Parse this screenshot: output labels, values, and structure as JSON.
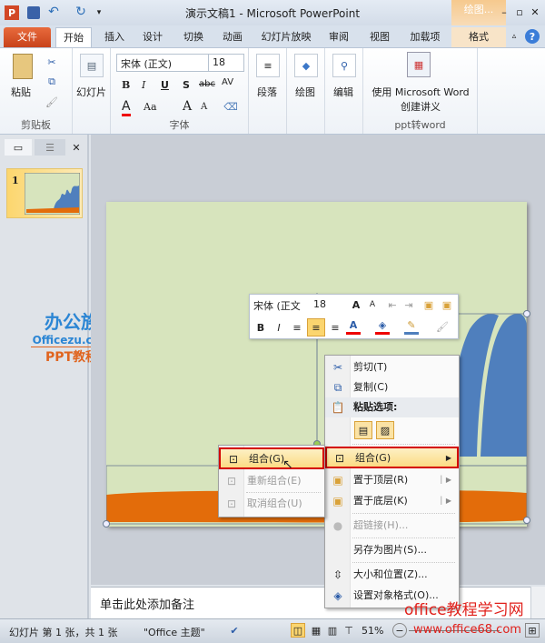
{
  "window": {
    "title": "演示文稿1  -  Microsoft PowerPoint",
    "context_tab": "绘图...",
    "app_icon": "P"
  },
  "tabs": [
    "文件",
    "开始",
    "插入",
    "设计",
    "切换",
    "动画",
    "幻灯片放映",
    "审阅",
    "视图",
    "加载项",
    "格式"
  ],
  "ribbon": {
    "clipboard": {
      "label": "剪贴板",
      "paste": "粘贴"
    },
    "slides": {
      "label": "幻灯片"
    },
    "font": {
      "label": "字体",
      "font_name": "宋体 (正文)",
      "font_size": "18",
      "bold": "B",
      "italic": "I",
      "underline": "U",
      "shadow": "S",
      "strike": "abc",
      "spacing": "AV",
      "color": "A",
      "case": "Aa",
      "grow": "A",
      "shrink": "A"
    },
    "paragraph": {
      "label": "段落"
    },
    "drawing": {
      "label": "绘图"
    },
    "editing": {
      "label": "编辑"
    },
    "word": {
      "button": "使用 Microsoft Word",
      "button2": "创建讲义",
      "label": "ppt转word"
    }
  },
  "slide_panel": {
    "slide_number": "1"
  },
  "watermark": {
    "brand": "办公族",
    "site": "Officezu.com",
    "sub": "PPT教程",
    "site2": "office教程学习网",
    "url": "www.office68.com"
  },
  "mini_toolbar": {
    "font": "宋体 (正文",
    "size": "18",
    "bold": "B",
    "italic": "I"
  },
  "context_menu": {
    "items": [
      {
        "label": "剪切(T)",
        "icon": "scissors-icon"
      },
      {
        "label": "复制(C)",
        "icon": "copy-icon"
      },
      {
        "label": "粘贴选项:",
        "icon": "paste-icon"
      },
      {
        "label": "组合(G)",
        "icon": "group-icon"
      },
      {
        "label": "置于顶层(R)",
        "icon": "bring-front-icon"
      },
      {
        "label": "置于底层(K)",
        "icon": "send-back-icon"
      },
      {
        "label": "超链接(H)...",
        "icon": "hyperlink-icon"
      },
      {
        "label": "另存为图片(S)..."
      },
      {
        "label": "大小和位置(Z)...",
        "icon": "size-icon"
      },
      {
        "label": "设置对象格式(O)...",
        "icon": "format-icon"
      }
    ]
  },
  "submenu": {
    "items": [
      "组合(G)",
      "重新组合(E)",
      "取消组合(U)"
    ]
  },
  "notes": {
    "placeholder": "单击此处添加备注"
  },
  "status": {
    "slide": "幻灯片 第 1 张，共 1 张",
    "theme": "\"Office 主题\"",
    "zoom": "51%"
  }
}
